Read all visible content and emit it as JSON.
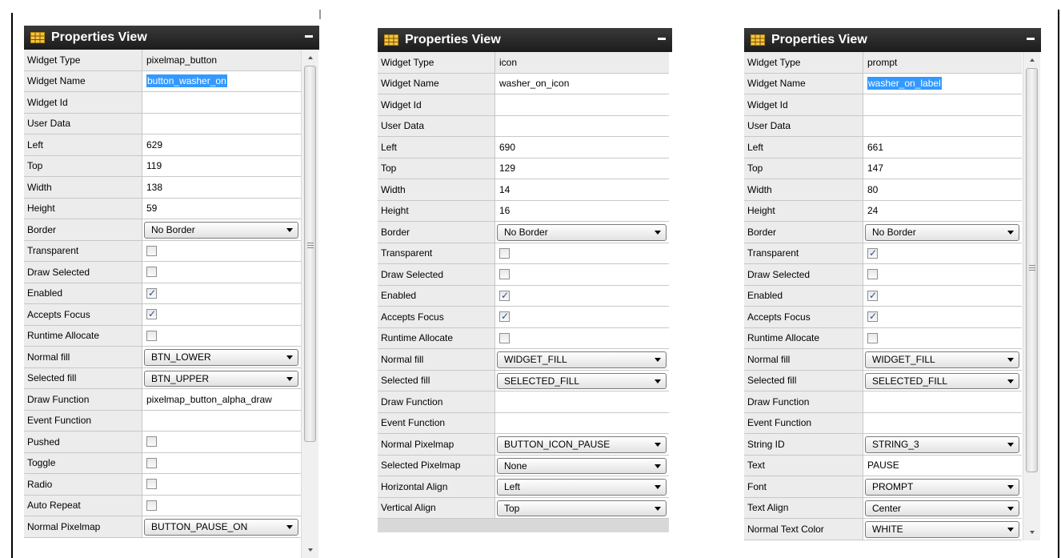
{
  "panel_title": "Properties View",
  "panels": [
    {
      "id": "left",
      "rows": [
        {
          "label": "Widget Type",
          "type": "text",
          "value": "pixelmap_button"
        },
        {
          "label": "Widget Name",
          "type": "selected",
          "value": "button_washer_on"
        },
        {
          "label": "Widget Id",
          "type": "blank",
          "value": ""
        },
        {
          "label": "User Data",
          "type": "blank",
          "value": ""
        },
        {
          "label": "Left",
          "type": "input",
          "value": "629"
        },
        {
          "label": "Top",
          "type": "input",
          "value": "119"
        },
        {
          "label": "Width",
          "type": "input",
          "value": "138"
        },
        {
          "label": "Height",
          "type": "input",
          "value": "59"
        },
        {
          "label": "Border",
          "type": "combo",
          "value": "No Border"
        },
        {
          "label": "Transparent",
          "type": "check",
          "checked": false
        },
        {
          "label": "Draw Selected",
          "type": "check",
          "checked": false
        },
        {
          "label": "Enabled",
          "type": "check",
          "checked": true
        },
        {
          "label": "Accepts Focus",
          "type": "check",
          "checked": true
        },
        {
          "label": "Runtime Allocate",
          "type": "check",
          "checked": false
        },
        {
          "label": "Normal fill",
          "type": "combo",
          "value": "BTN_LOWER"
        },
        {
          "label": "Selected fill",
          "type": "combo",
          "value": "BTN_UPPER"
        },
        {
          "label": "Draw Function",
          "type": "input",
          "value": "pixelmap_button_alpha_draw"
        },
        {
          "label": "Event Function",
          "type": "blank",
          "value": ""
        },
        {
          "label": "Pushed",
          "type": "check",
          "checked": false
        },
        {
          "label": "Toggle",
          "type": "check",
          "checked": false
        },
        {
          "label": "Radio",
          "type": "check",
          "checked": false
        },
        {
          "label": "Auto Repeat",
          "type": "check",
          "checked": false
        },
        {
          "label": "Normal Pixelmap",
          "type": "combo",
          "value": "BUTTON_PAUSE_ON"
        }
      ]
    },
    {
      "id": "middle",
      "rows": [
        {
          "label": "Widget Type",
          "type": "text",
          "value": "icon"
        },
        {
          "label": "Widget Name",
          "type": "input",
          "value": "washer_on_icon"
        },
        {
          "label": "Widget Id",
          "type": "blank",
          "value": ""
        },
        {
          "label": "User Data",
          "type": "blank",
          "value": ""
        },
        {
          "label": "Left",
          "type": "input",
          "value": "690"
        },
        {
          "label": "Top",
          "type": "input",
          "value": "129"
        },
        {
          "label": "Width",
          "type": "input",
          "value": "14"
        },
        {
          "label": "Height",
          "type": "input",
          "value": "16"
        },
        {
          "label": "Border",
          "type": "combo",
          "value": "No Border"
        },
        {
          "label": "Transparent",
          "type": "check",
          "checked": false
        },
        {
          "label": "Draw Selected",
          "type": "check",
          "checked": false
        },
        {
          "label": "Enabled",
          "type": "check",
          "checked": true
        },
        {
          "label": "Accepts Focus",
          "type": "check",
          "checked": true
        },
        {
          "label": "Runtime Allocate",
          "type": "check",
          "checked": false
        },
        {
          "label": "Normal fill",
          "type": "combo",
          "value": "WIDGET_FILL"
        },
        {
          "label": "Selected fill",
          "type": "combo",
          "value": "SELECTED_FILL"
        },
        {
          "label": "Draw Function",
          "type": "blank",
          "value": ""
        },
        {
          "label": "Event Function",
          "type": "blank",
          "value": ""
        },
        {
          "label": "Normal Pixelmap",
          "type": "combo",
          "value": "BUTTON_ICON_PAUSE"
        },
        {
          "label": "Selected Pixelmap",
          "type": "combo",
          "value": "None"
        },
        {
          "label": "Horizontal Align",
          "type": "combo",
          "value": "Left"
        },
        {
          "label": "Vertical Align",
          "type": "combo",
          "value": "Top"
        }
      ]
    },
    {
      "id": "right",
      "rows": [
        {
          "label": "Widget Type",
          "type": "text",
          "value": "prompt"
        },
        {
          "label": "Widget Name",
          "type": "selected",
          "value": "washer_on_label"
        },
        {
          "label": "Widget Id",
          "type": "blank",
          "value": ""
        },
        {
          "label": "User Data",
          "type": "blank",
          "value": ""
        },
        {
          "label": "Left",
          "type": "input",
          "value": "661"
        },
        {
          "label": "Top",
          "type": "input",
          "value": "147"
        },
        {
          "label": "Width",
          "type": "input",
          "value": "80"
        },
        {
          "label": "Height",
          "type": "input",
          "value": "24"
        },
        {
          "label": "Border",
          "type": "combo",
          "value": "No Border"
        },
        {
          "label": "Transparent",
          "type": "check",
          "checked": true
        },
        {
          "label": "Draw Selected",
          "type": "check",
          "checked": false
        },
        {
          "label": "Enabled",
          "type": "check",
          "checked": true
        },
        {
          "label": "Accepts Focus",
          "type": "check",
          "checked": true
        },
        {
          "label": "Runtime Allocate",
          "type": "check",
          "checked": false
        },
        {
          "label": "Normal fill",
          "type": "combo",
          "value": "WIDGET_FILL"
        },
        {
          "label": "Selected fill",
          "type": "combo",
          "value": "SELECTED_FILL"
        },
        {
          "label": "Draw Function",
          "type": "blank",
          "value": ""
        },
        {
          "label": "Event Function",
          "type": "blank",
          "value": ""
        },
        {
          "label": "String ID",
          "type": "combo",
          "value": "STRING_3"
        },
        {
          "label": "Text",
          "type": "input",
          "value": "PAUSE"
        },
        {
          "label": "Font",
          "type": "combo",
          "value": "PROMPT"
        },
        {
          "label": "Text Align",
          "type": "combo",
          "value": "Center"
        },
        {
          "label": "Normal Text Color",
          "type": "combo",
          "value": "WHITE"
        }
      ]
    }
  ]
}
